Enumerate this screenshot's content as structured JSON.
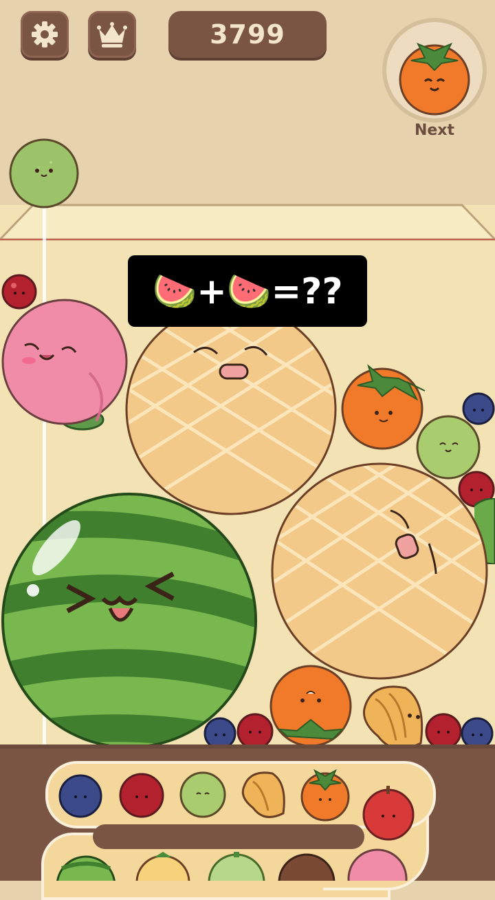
{
  "hud": {
    "settings_icon": "gear-icon",
    "ranking_icon": "crown-icon",
    "score": "3799",
    "next_label": "Next",
    "next_fruit": "persimmon"
  },
  "caption": {
    "text": "🍉+🍉=??"
  },
  "colors": {
    "frame_brown": "#7a5544",
    "background": "#e6d2ad",
    "container": "#f3e3b4",
    "danger_line": "#c86155"
  },
  "board": {
    "dropping_fruit": "lime",
    "fruits": [
      "cherry",
      "peach",
      "melon",
      "persimmon",
      "blueberry",
      "lime",
      "cherry",
      "melon",
      "watermelon",
      "orange",
      "banana",
      "blueberry",
      "cherry",
      "cherry",
      "blueberry"
    ]
  },
  "evolution": [
    "blueberry",
    "cherry",
    "lime",
    "banana",
    "persimmon",
    "apple",
    "peach",
    "pear",
    "melon",
    "watermelon"
  ]
}
